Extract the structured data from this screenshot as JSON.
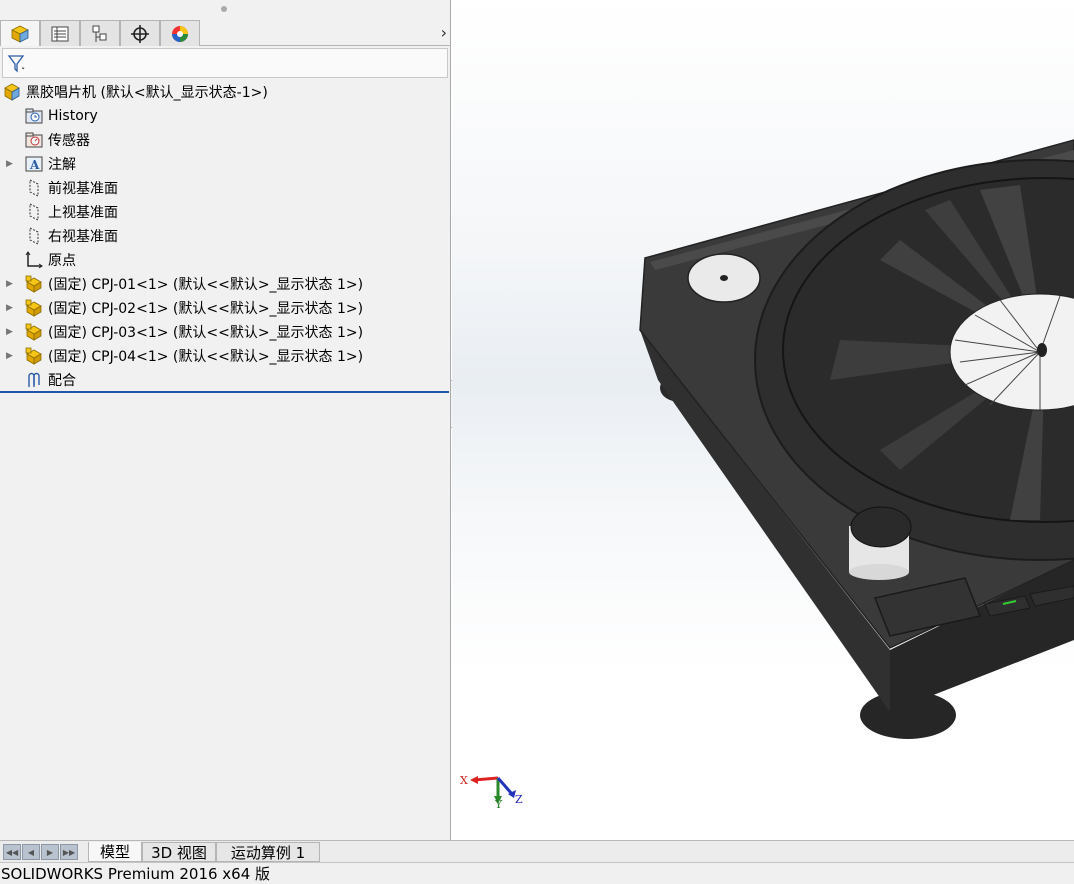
{
  "feature_tree": {
    "root": {
      "label": "黑胶唱片机  (默认<默认_显示状态-1>)",
      "icon": "assembly-icon"
    },
    "items": [
      {
        "label": "History",
        "icon": "history-folder-icon",
        "expandable": false
      },
      {
        "label": "传感器",
        "icon": "sensor-folder-icon",
        "expandable": false
      },
      {
        "label": "注解",
        "icon": "annotations-icon",
        "expandable": true
      },
      {
        "label": "前视基准面",
        "icon": "plane-icon",
        "expandable": false
      },
      {
        "label": "上视基准面",
        "icon": "plane-icon",
        "expandable": false
      },
      {
        "label": "右视基准面",
        "icon": "plane-icon",
        "expandable": false
      },
      {
        "label": "原点",
        "icon": "origin-icon",
        "expandable": false
      },
      {
        "label": "(固定) CPJ-01<1> (默认<<默认>_显示状态 1>)",
        "icon": "part-icon",
        "expandable": true
      },
      {
        "label": "(固定) CPJ-02<1> (默认<<默认>_显示状态 1>)",
        "icon": "part-icon",
        "expandable": true
      },
      {
        "label": "(固定) CPJ-03<1> (默认<<默认>_显示状态 1>)",
        "icon": "part-icon",
        "expandable": true
      },
      {
        "label": "(固定) CPJ-04<1> (默认<<默认>_显示状态 1>)",
        "icon": "part-icon",
        "expandable": true
      },
      {
        "label": "配合",
        "icon": "mates-icon",
        "expandable": false
      }
    ]
  },
  "manager_tabs": [
    "featuremanager-tab",
    "propertymanager-tab",
    "configurationmanager-tab",
    "dimxpert-tab",
    "displaymanager-tab"
  ],
  "triad": {
    "x": "X",
    "y": "Y",
    "z": "Z"
  },
  "bottom_tabs": {
    "model": "模型",
    "view3d": "3D 视图",
    "motion": "运动算例 1"
  },
  "status": {
    "text": "SOLIDWORKS Premium 2016 x64 版"
  },
  "colors": {
    "accent": "#2255aa",
    "model_body": "#3a3a3a",
    "record": "#2c2c2c"
  }
}
